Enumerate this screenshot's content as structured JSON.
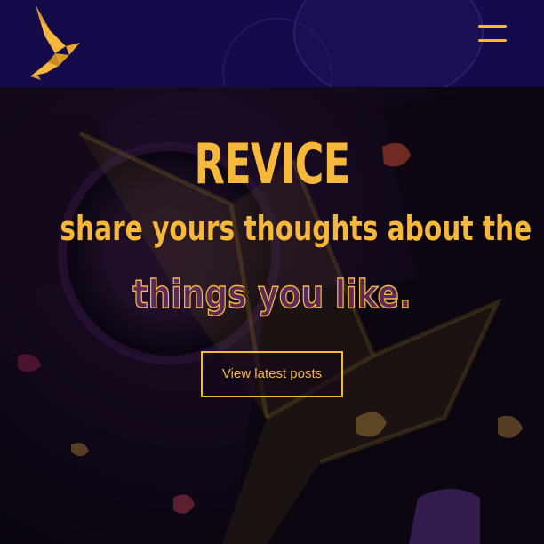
{
  "header": {
    "logo_icon": "origami-bird-icon",
    "menu_icon": "hamburger-menu-icon"
  },
  "hero": {
    "title": "REVICE",
    "subtitle_line1": "share yours thoughts about the",
    "subtitle_line2": "things you like.",
    "cta_label": "View latest posts"
  },
  "colors": {
    "accent": "#f5b83a",
    "header_bg": "#150a4a",
    "page_bg": "#0a0610"
  }
}
